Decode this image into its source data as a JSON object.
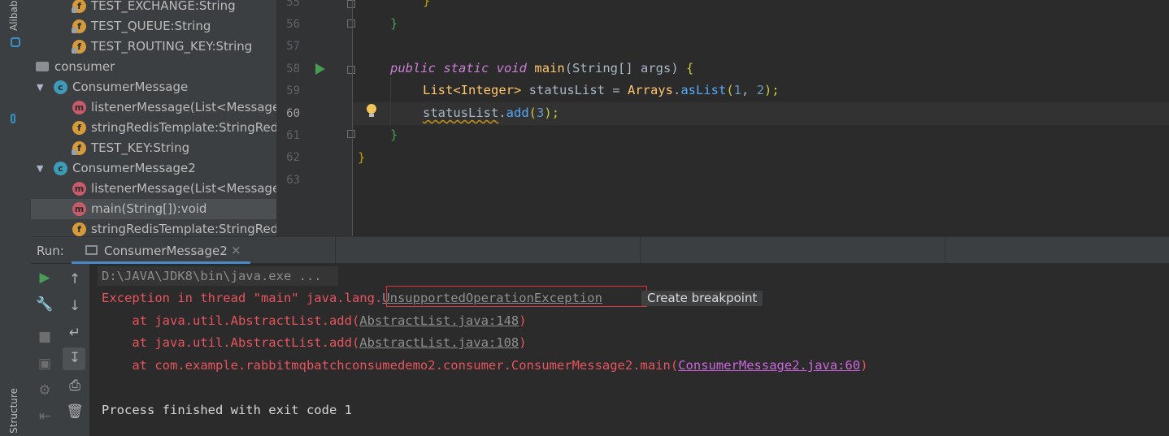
{
  "left_strip": {
    "top_label": "Alibab",
    "bottom_label": "Structure"
  },
  "structure": {
    "rows": [
      {
        "kind": "field",
        "badge": "f",
        "label": "TEST_EXCHANGE:String"
      },
      {
        "kind": "field",
        "badge": "f",
        "label": "TEST_QUEUE:String"
      },
      {
        "kind": "field",
        "badge": "f",
        "label": "TEST_ROUTING_KEY:String"
      },
      {
        "kind": "package",
        "label": "consumer"
      },
      {
        "kind": "class",
        "badge": "c",
        "label": "ConsumerMessage"
      },
      {
        "kind": "method",
        "badge": "m",
        "label": "listenerMessage(List<Message:"
      },
      {
        "kind": "field",
        "badge": "f",
        "label": "stringRedisTemplate:StringRed"
      },
      {
        "kind": "field",
        "badge": "f",
        "label": "TEST_KEY:String"
      },
      {
        "kind": "class",
        "badge": "c",
        "label": "ConsumerMessage2"
      },
      {
        "kind": "method",
        "badge": "m",
        "label": "listenerMessage(List<Message:"
      },
      {
        "kind": "method",
        "badge": "m",
        "label": "main(String[]):void"
      },
      {
        "kind": "field",
        "badge": "f",
        "label": "stringRedisTemplate:StringRed"
      }
    ]
  },
  "editor": {
    "line_numbers": [
      "55",
      "56",
      "57",
      "58",
      "59",
      "60",
      "61",
      "62",
      "63"
    ],
    "current_line": "60",
    "code": {
      "l55": "}",
      "l56": "}",
      "l58_kw1": "public",
      "l58_kw2": "static",
      "l58_kw3": "void",
      "l58_fn": "main",
      "l58_rest": "(String[] args) ",
      "l58_brace": "{",
      "l59_type": "List<Integer>",
      "l59_mid": " statusList = ",
      "l59_cls": "Arrays",
      "l59_dot": ".",
      "l59_call": "asList",
      "l59_open": "(",
      "l59_n1": "1",
      "l59_comma": ", ",
      "l59_n2": "2",
      "l59_close": ");",
      "l60_var": "statusList",
      "l60_dot": ".",
      "l60_call": "add",
      "l60_open": "(",
      "l60_n": "3",
      "l60_close": ");",
      "l61": "}",
      "l62": "}"
    }
  },
  "run": {
    "label": "Run:",
    "tab_label": "ConsumerMessage2",
    "tab_close": "×",
    "toolbar1": [
      "rerun",
      "wrench",
      "stop",
      "camera",
      "settings",
      "exit"
    ],
    "toolbar2": [
      "up-arrow",
      "down-arrow",
      "soft-wrap",
      "scroll-to-end",
      "print",
      "trash"
    ]
  },
  "console": {
    "cmd": "D:\\JAVA\\JDK8\\bin\\java.exe ...",
    "exc_prefix": "Exception in thread \"main\" java.lang.",
    "exc_link": "UnsupportedOperationException",
    "tooltip": "Create breakpoint",
    "trace": [
      {
        "prefix": "    at java.util.AbstractList.add(",
        "link": "AbstractList.java:148",
        "suffix": ")"
      },
      {
        "prefix": "    at java.util.AbstractList.add(",
        "link": "AbstractList.java:108",
        "suffix": ")"
      },
      {
        "prefix": "    at com.example.rabbitmqbatchconsumedemo2.consumer.ConsumerMessage2.main(",
        "link": "ConsumerMessage2.java:60",
        "suffix": ")"
      }
    ],
    "exit": "Process finished with exit code 1"
  },
  "colors": {
    "background": "#2b2b2b",
    "panel": "#3c3f41",
    "error": "#e8545e",
    "accent": "#4a88c7",
    "highlight_box": "#e0303a"
  }
}
